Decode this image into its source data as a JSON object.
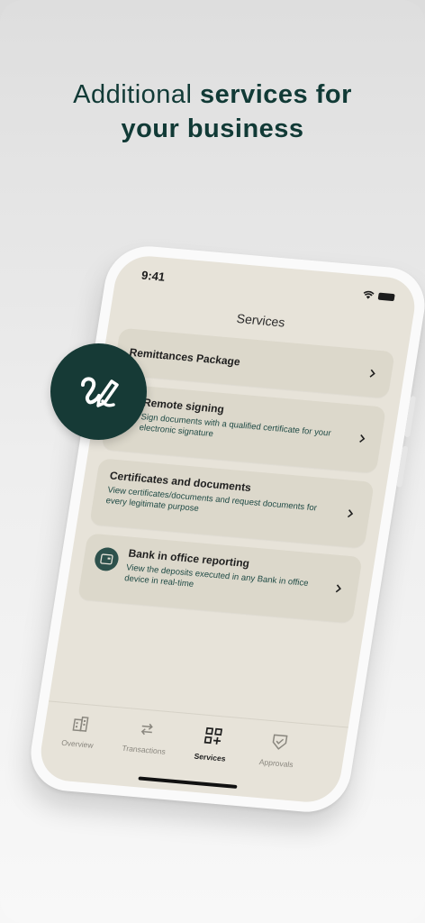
{
  "headline": {
    "light": "Additional",
    "bold_1": "services for",
    "bold_2": "your business"
  },
  "status_bar": {
    "time": "9:41"
  },
  "screen": {
    "title": "Services"
  },
  "services": [
    {
      "title": "Remittances Package",
      "description": ""
    },
    {
      "title": "Remote signing",
      "description": "Sign documents with a qualified certificate for your electronic signature"
    },
    {
      "title": "Certificates and documents",
      "description": "View certificates/documents and request documents for every legitimate purpose"
    },
    {
      "title": "Bank in office reporting",
      "description": "View the deposits executed in any Bank in office device in real-time"
    }
  ],
  "tabbar": [
    {
      "label": "Overview",
      "icon": "building-icon"
    },
    {
      "label": "Transactions",
      "icon": "transfer-arrows-icon"
    },
    {
      "label": "Services",
      "icon": "services-grid-icon",
      "active": true
    },
    {
      "label": "Approvals",
      "icon": "approval-shield-icon"
    }
  ],
  "colors": {
    "brand_dark": "#163a36",
    "screen_bg": "#e7e3d9",
    "card_bg": "#dcd8cb"
  }
}
